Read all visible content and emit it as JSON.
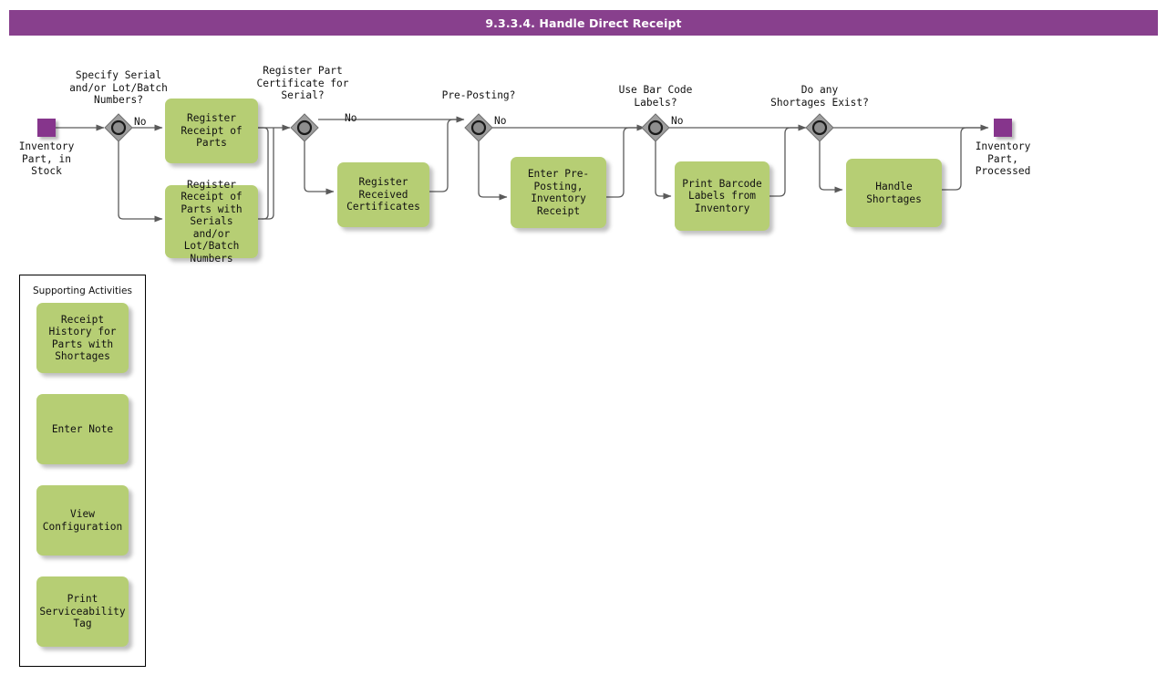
{
  "header": {
    "title": "9.3.3.4. Handle Direct Receipt",
    "bar_color": "#88408d"
  },
  "theme": {
    "task_fill": "#b6ce74",
    "event_fill": "#86358c",
    "gateway_fill": "#9e9e9e",
    "line_color": "#5a5a5a",
    "text_color": "#111111"
  },
  "flow": {
    "start_event": {
      "name": "start-event",
      "label": "Inventory\nPart, in\nStock"
    },
    "end_event": {
      "name": "end-event",
      "label": "Inventory\nPart,\nProcessed"
    },
    "gateways": [
      {
        "id": "gw-specify-serial",
        "label": "Specify Serial\nand/or Lot/Batch\nNumbers?",
        "branch_label": "No"
      },
      {
        "id": "gw-register-part-certificate",
        "label": "Register Part\nCertificate for\nSerial?",
        "branch_label": "No"
      },
      {
        "id": "gw-pre-posting",
        "label": "Pre-Posting?",
        "branch_label": "No"
      },
      {
        "id": "gw-use-bar-code-labels",
        "label": "Use Bar Code\nLabels?",
        "branch_label": "No"
      },
      {
        "id": "gw-shortages-exist",
        "label": "Do any\nShortages Exist?",
        "branch_label": ""
      }
    ],
    "tasks": [
      {
        "id": "task-register-receipt-of-parts",
        "label": "Register Receipt\nof Parts"
      },
      {
        "id": "task-register-receipt-of-parts-with-serials",
        "label": "Register Receipt\nof Parts with\nSerials and/or\nLot/Batch\nNumbers"
      },
      {
        "id": "task-register-received-certificates",
        "label": "Register\nReceived\nCertificates"
      },
      {
        "id": "task-enter-pre-posting-inventory-receipt",
        "label": "Enter Pre-\nPosting,\nInventory\nReceipt"
      },
      {
        "id": "task-print-barcode-labels-from-inventory",
        "label": "Print Barcode\nLabels from\nInventory"
      },
      {
        "id": "task-handle-shortages",
        "label": "Handle\nShortages"
      }
    ]
  },
  "supporting_activities": {
    "title": "Supporting Activities",
    "items": [
      {
        "id": "support-receipt-history",
        "label": "Receipt History\nfor Parts with\nShortages"
      },
      {
        "id": "support-enter-note",
        "label": "Enter Note"
      },
      {
        "id": "support-view-configuration",
        "label": "View\nConfiguration"
      },
      {
        "id": "support-print-serviceability-tag",
        "label": "Print\nServiceability\nTag"
      }
    ]
  }
}
